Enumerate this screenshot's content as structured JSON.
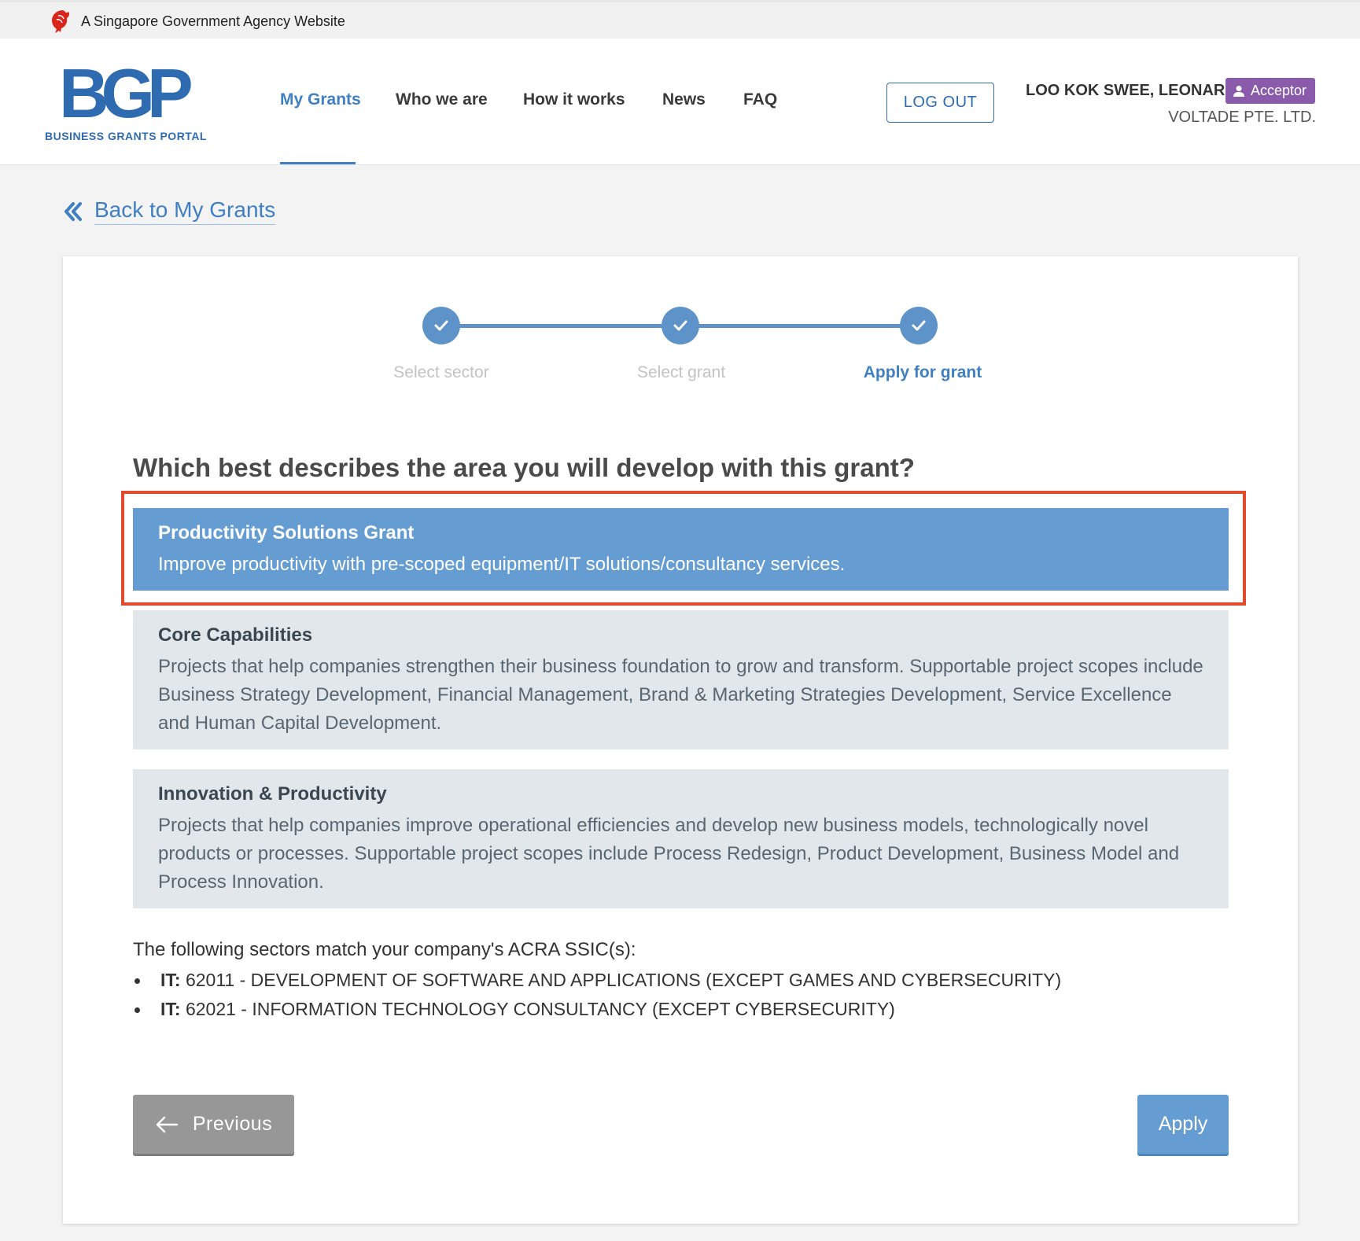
{
  "gov_banner": {
    "text": "A Singapore Government Agency Website"
  },
  "logo": {
    "mark": "BGP",
    "subtitle": "BUSINESS GRANTS PORTAL"
  },
  "nav": {
    "items": [
      {
        "label": "My Grants",
        "active": true
      },
      {
        "label": "Who we are"
      },
      {
        "label": "How it works"
      },
      {
        "label": "News"
      },
      {
        "label": "FAQ"
      }
    ]
  },
  "header": {
    "logout_label": "LOG OUT",
    "user_name": "LOO KOK SWEE, LEONARD",
    "role": "Acceptor",
    "company": "VOLTADE PTE. LTD."
  },
  "back_link": {
    "label": "Back to My Grants"
  },
  "stepper": {
    "steps": [
      {
        "label": "Select sector",
        "status": "done"
      },
      {
        "label": "Select grant",
        "status": "done"
      },
      {
        "label": "Apply for grant",
        "status": "current"
      }
    ]
  },
  "question": "Which best describes the area you will develop with this grant?",
  "options": [
    {
      "title": "Productivity Solutions Grant",
      "description": "Improve productivity with pre-scoped equipment/IT solutions/consultancy services.",
      "selected": true
    },
    {
      "title": "Core Capabilities",
      "description": "Projects that help companies strengthen their business foundation to grow and transform. Supportable project scopes include Business Strategy Development, Financial Management, Brand & Marketing Strategies Development, Service Excellence and Human Capital Development."
    },
    {
      "title": "Innovation & Productivity",
      "description": "Projects that help companies improve operational efficiencies and develop new business models, technologically novel products or processes. Supportable project scopes include Process Redesign, Product Development, Business Model and Process Innovation."
    }
  ],
  "sectors": {
    "intro": "The following sectors match your company's ACRA SSIC(s):",
    "items": [
      {
        "sector": "IT:",
        "detail": " 62011 - DEVELOPMENT OF SOFTWARE AND APPLICATIONS (EXCEPT GAMES AND CYBERSECURITY)"
      },
      {
        "sector": "IT:",
        "detail": " 62021 - INFORMATION TECHNOLOGY CONSULTANCY (EXCEPT CYBERSECURITY)"
      }
    ]
  },
  "buttons": {
    "previous": "Previous",
    "apply": "Apply"
  },
  "colors": {
    "primary": "#3f7fc2",
    "selected_option": "#659dd2",
    "option_bg": "#e1e7eb",
    "role_badge": "#8a5bab",
    "highlight": "#e24a2e"
  }
}
